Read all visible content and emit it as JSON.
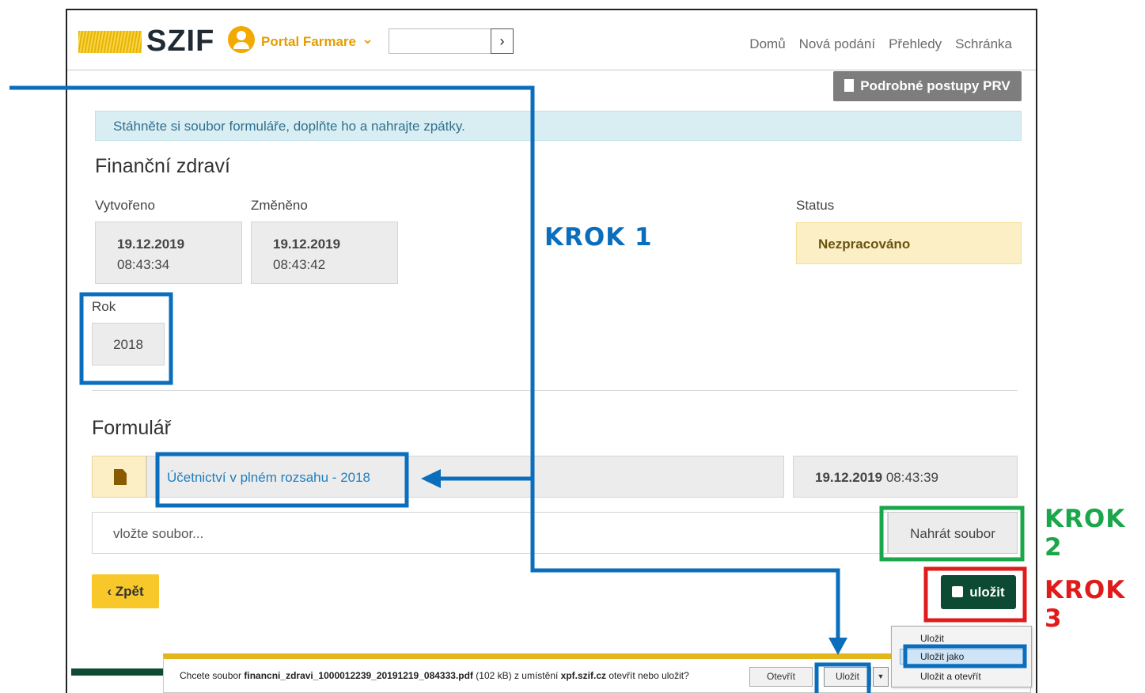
{
  "header": {
    "logo_text": "SZIF",
    "portal_label": "Portal Farmare",
    "search_value": "",
    "nav": [
      "Domů",
      "Nová podání",
      "Přehledy",
      "Schránka"
    ]
  },
  "prv_button": "Podrobné postupy PRV",
  "alert_text": "Stáhněte si soubor formuláře, doplňte ho a nahrajte zpátky.",
  "financni": {
    "title": "Finanční zdraví",
    "created_label": "Vytvořeno",
    "created_date": "19.12.2019",
    "created_time": "08:43:34",
    "changed_label": "Změněno",
    "changed_date": "19.12.2019",
    "changed_time": "08:43:42",
    "status_label": "Status",
    "status_value": "Nezpracováno",
    "year_label": "Rok",
    "year_value": "2018"
  },
  "formular": {
    "title": "Formulář",
    "file_name": "Účetnictví v plném rozsahu - 2018",
    "file_date": "19.12.2019",
    "file_time": "08:43:39",
    "upload_placeholder": "vložte soubor...",
    "upload_button": "Nahrát soubor"
  },
  "buttons": {
    "back": "Zpět",
    "save": "uložit"
  },
  "download_bar": {
    "prefix": "Chcete soubor",
    "file": "financni_zdravi_1000012239_20191219_084333.pdf",
    "size": "(102 kB) z umístění",
    "host": "xpf.szif.cz",
    "suffix": "otevřít nebo uložit?",
    "open": "Otevřít",
    "save": "Uložit"
  },
  "save_menu": [
    "Uložit",
    "Uložit jako",
    "Uložit a otevřít"
  ],
  "annotations": {
    "krok1": "KROK 1",
    "krok2": "KROK 2",
    "krok3": "KROK 3"
  },
  "colors": {
    "krok1": "#0a6ebd",
    "krok2": "#1aa64a",
    "krok3": "#e01b1b",
    "save_button": "#0c4a33",
    "back_button": "#f8c82a",
    "accent_orange": "#e59e00"
  }
}
